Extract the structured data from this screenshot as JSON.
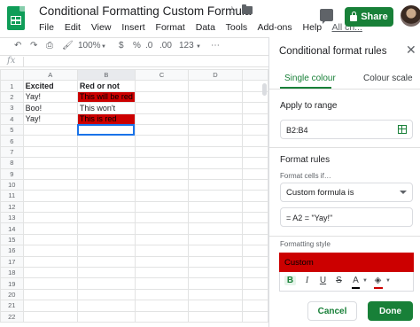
{
  "app": {
    "title": "Conditional Formatting Custom Formula",
    "menu": [
      "File",
      "Edit",
      "View",
      "Insert",
      "Format",
      "Data",
      "Tools",
      "Add-ons",
      "Help"
    ],
    "all_changes": "All ch...",
    "share_label": "Share"
  },
  "toolbar": {
    "zoom": "100%",
    "currency": "$",
    "percent": "%",
    "decimal_dec": ".0",
    "decimal_inc": ".00",
    "number_format": "123"
  },
  "formula_bar": {
    "fx": "fx",
    "value": ""
  },
  "sheet": {
    "columns": [
      "A",
      "B",
      "C",
      "D"
    ],
    "rows": [
      "1",
      "2",
      "3",
      "4",
      "5",
      "6",
      "7",
      "8",
      "9",
      "10",
      "11",
      "12",
      "13",
      "14",
      "15",
      "16",
      "17",
      "18",
      "19",
      "20",
      "21",
      "22"
    ],
    "cells": {
      "A1": "Excited",
      "B1": "Red or not",
      "A2": "Yay!",
      "B2": "This will be red",
      "A3": "Boo!",
      "B3": "This won't",
      "A4": "Yay!",
      "B4": "This is red"
    },
    "highlight_color": "#cc0000"
  },
  "panel": {
    "title": "Conditional format rules",
    "tabs": [
      "Single colour",
      "Colour scale"
    ],
    "apply_to_range_label": "Apply to range",
    "range_value": "B2:B4",
    "format_rules_label": "Format rules",
    "format_cells_if_label": "Format cells if…",
    "condition": "Custom formula is",
    "formula_value": "= A2 = \"Yay!\"",
    "formatting_style_label": "Formatting style",
    "style_preview": "Custom",
    "style_tools": {
      "bold": "B",
      "italic": "I",
      "underline": "U",
      "strikethrough": "S",
      "text_color": "A"
    },
    "cancel_label": "Cancel",
    "done_label": "Done",
    "accent_color": "#188038"
  }
}
